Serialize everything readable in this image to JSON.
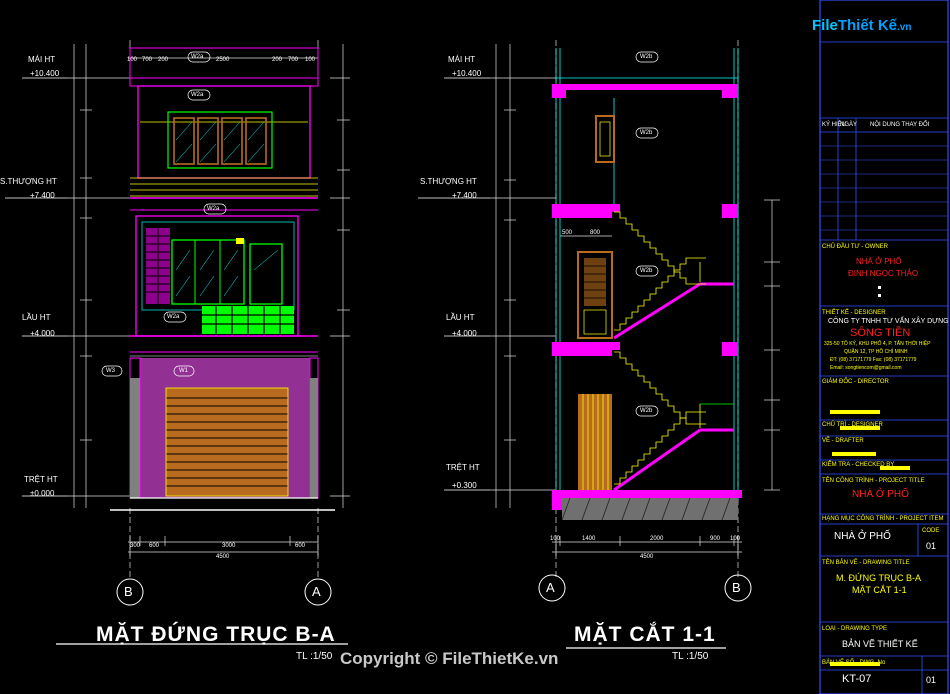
{
  "watermark": "Copyright © FileThietKe.vn",
  "logo": {
    "file": "File",
    "rest": "Thiết Kế",
    "vn": ".vn"
  },
  "elevation": {
    "title": "MẶT ĐỨNG TRỤC B-A",
    "scale": "TL :1/50",
    "levels": [
      {
        "name": "MÁI HT",
        "value": "+10.400"
      },
      {
        "name": "S.THƯỢNG HT",
        "value": "+7.400"
      },
      {
        "name": "LẦU HT",
        "value": "+4.000"
      },
      {
        "name": "TRỆT HT",
        "value": "±0.000"
      }
    ],
    "top_dims": [
      "100",
      "700",
      "200",
      "2500",
      "200",
      "700",
      "100"
    ],
    "bottom_dims": [
      "300",
      "600",
      "3000",
      "600"
    ],
    "total": "4500",
    "axes": [
      "B",
      "A"
    ],
    "tags": [
      "W2a",
      "W2a",
      "W2a",
      "W2a",
      "W3",
      "W1"
    ]
  },
  "section": {
    "title": "MẶT CẮT 1-1",
    "scale": "TL :1/50",
    "levels": [
      {
        "name": "MÁI HT",
        "value": "+10.400"
      },
      {
        "name": "S.THƯỢNG HT",
        "value": "+7.400"
      },
      {
        "name": "LẦU HT",
        "value": "+4.000"
      },
      {
        "name": "TRỆT HT",
        "value": "+0.300"
      }
    ],
    "bottom_dims": [
      "100",
      "1400",
      "2000",
      "900",
      "100"
    ],
    "total": "4500",
    "inner_dims": [
      "500",
      "800"
    ],
    "axes": [
      "A",
      "B"
    ],
    "tags": [
      "W2b",
      "W2b",
      "W2b",
      "W2b"
    ]
  },
  "title_block": {
    "rev_headers": [
      "KÝ HIỆU",
      "NGÀY",
      "NỘI DUNG THAY ĐỔI"
    ],
    "owner_label": "CHỦ ĐẦU TƯ - OWNER",
    "owner": [
      "NHÀ Ở PHỐ",
      "ĐINH NGỌC THẢO"
    ],
    "designer_label": "THIẾT KẾ - DESIGNER",
    "company": "CÔNG TY TNHH TƯ VẤN XÂY DỰNG",
    "company_name": "SÔNG TIỀN",
    "address": [
      "325-50 TÔ KÝ, KHU PHỐ 4, P. TÂN THỚI HIỆP",
      "QUẬN 12, TP HỒ CHÍ MINH",
      "ĐT: (08) 37171779  Fax: (08) 37171779",
      "Email: songtiencom@gmail.com"
    ],
    "director_label": "GIÁM ĐỐC - DIRECTOR",
    "chief_label": "CHỦ TRÌ - DESIGNER",
    "drafter_label": "VẼ - DRAFTER",
    "checker_label": "KIỂM TRA - CHECKED BY",
    "project_label": "TÊN CÔNG TRÌNH - PROJECT TITLE",
    "project": "NHÀ Ở PHỐ",
    "item_label": "HẠNG MỤC CÔNG TRÌNH - PROJECT ITEM",
    "item": "NHÀ Ở PHỐ",
    "item_code_label": "CODE",
    "item_code": "01",
    "drawing_label": "TÊN BẢN VẼ - DRAWING TITLE",
    "drawing": [
      "M. ĐỨNG TRỤC B-A",
      "MẶT CẮT 1-1"
    ],
    "type_label": "LOẠI - DRAWING TYPE",
    "type": "BẢN VẼ THIẾT KẾ",
    "sheet_label": "BẢN VẼ SỐ - DWG. No",
    "sheet": "KT-07",
    "sheet_no": "01"
  },
  "colors": {
    "magenta": "#ff00ff",
    "cyan": "#00ffff",
    "yellow": "#ffff00",
    "green": "#00ff00",
    "red": "#ff2020",
    "brown": "#b86b1e",
    "blue": "#3050ff"
  }
}
